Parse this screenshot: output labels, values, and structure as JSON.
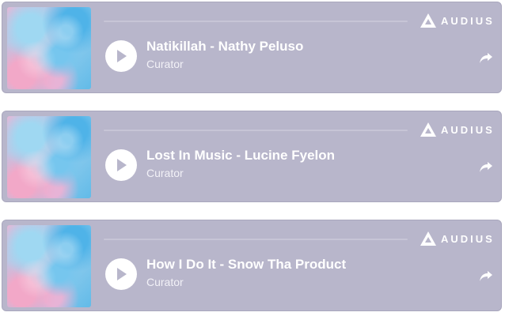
{
  "embeds": [
    {
      "title": "Natikillah - Nathy Peluso",
      "subtitle": "Curator",
      "brand": "AUDIUS"
    },
    {
      "title": "Lost In Music - Lucine Fyelon",
      "subtitle": "Curator",
      "brand": "AUDIUS"
    },
    {
      "title": "How I Do It - Snow Tha Product",
      "subtitle": "Curator",
      "brand": "AUDIUS"
    }
  ],
  "icons": {
    "play": "play-icon",
    "share": "share-icon",
    "logo": "audius-logo"
  },
  "colors": {
    "card_bg": "#b8b6cb",
    "text": "#ffffff",
    "progress": "#c7c5d6"
  }
}
